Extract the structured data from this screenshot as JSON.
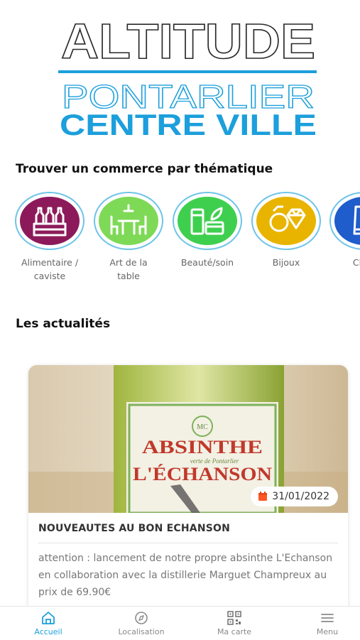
{
  "logo": {
    "line1": "ALTITUDE",
    "line2": "PONTARLIER",
    "line3": "CENTRE VILLE"
  },
  "themes": {
    "title": "Trouver un commerce par thématique",
    "items": [
      {
        "label_1": "Alimentaire /",
        "label_2": "caviste",
        "color": "#8c1a5a",
        "icon": "wine-bottles-icon"
      },
      {
        "label_1": "Art de la",
        "label_2": "table",
        "color": "#7ed957",
        "icon": "dining-table-icon"
      },
      {
        "label_1": "Beauté/soin",
        "label_2": "",
        "color": "#3fcf4f",
        "icon": "cosmetics-icon"
      },
      {
        "label_1": "Bijoux",
        "label_2": "",
        "color": "#e8b400",
        "icon": "diamond-ring-icon"
      },
      {
        "label_1": "Chau",
        "label_2": "",
        "color": "#1f5ccc",
        "icon": "boot-icon"
      }
    ]
  },
  "news": {
    "title": "Les actualités",
    "card": {
      "date": "31/01/2022",
      "headline": "NOUVEAUTES AU BON ECHANSON",
      "excerpt": "attention : lancement de notre propre absinthe L'Echanson en collaboration avec la distillerie Marguet Champreux au prix de 69.90€",
      "image_text_1": "ABSINTHE",
      "image_text_2": "L'ÉCHANSON",
      "image_text_small": "verte de Pontarlier",
      "image_monogram": "MC"
    }
  },
  "nav": {
    "items": [
      {
        "label": "Accueil",
        "icon": "home-icon",
        "active": true
      },
      {
        "label": "Localisation",
        "icon": "compass-icon",
        "active": false
      },
      {
        "label": "Ma carte",
        "icon": "qr-code-icon",
        "active": false
      },
      {
        "label": "Menu",
        "icon": "hamburger-icon",
        "active": false
      }
    ]
  },
  "colors": {
    "accent": "#1c9fdc",
    "badge_icon": "#ff5722"
  }
}
